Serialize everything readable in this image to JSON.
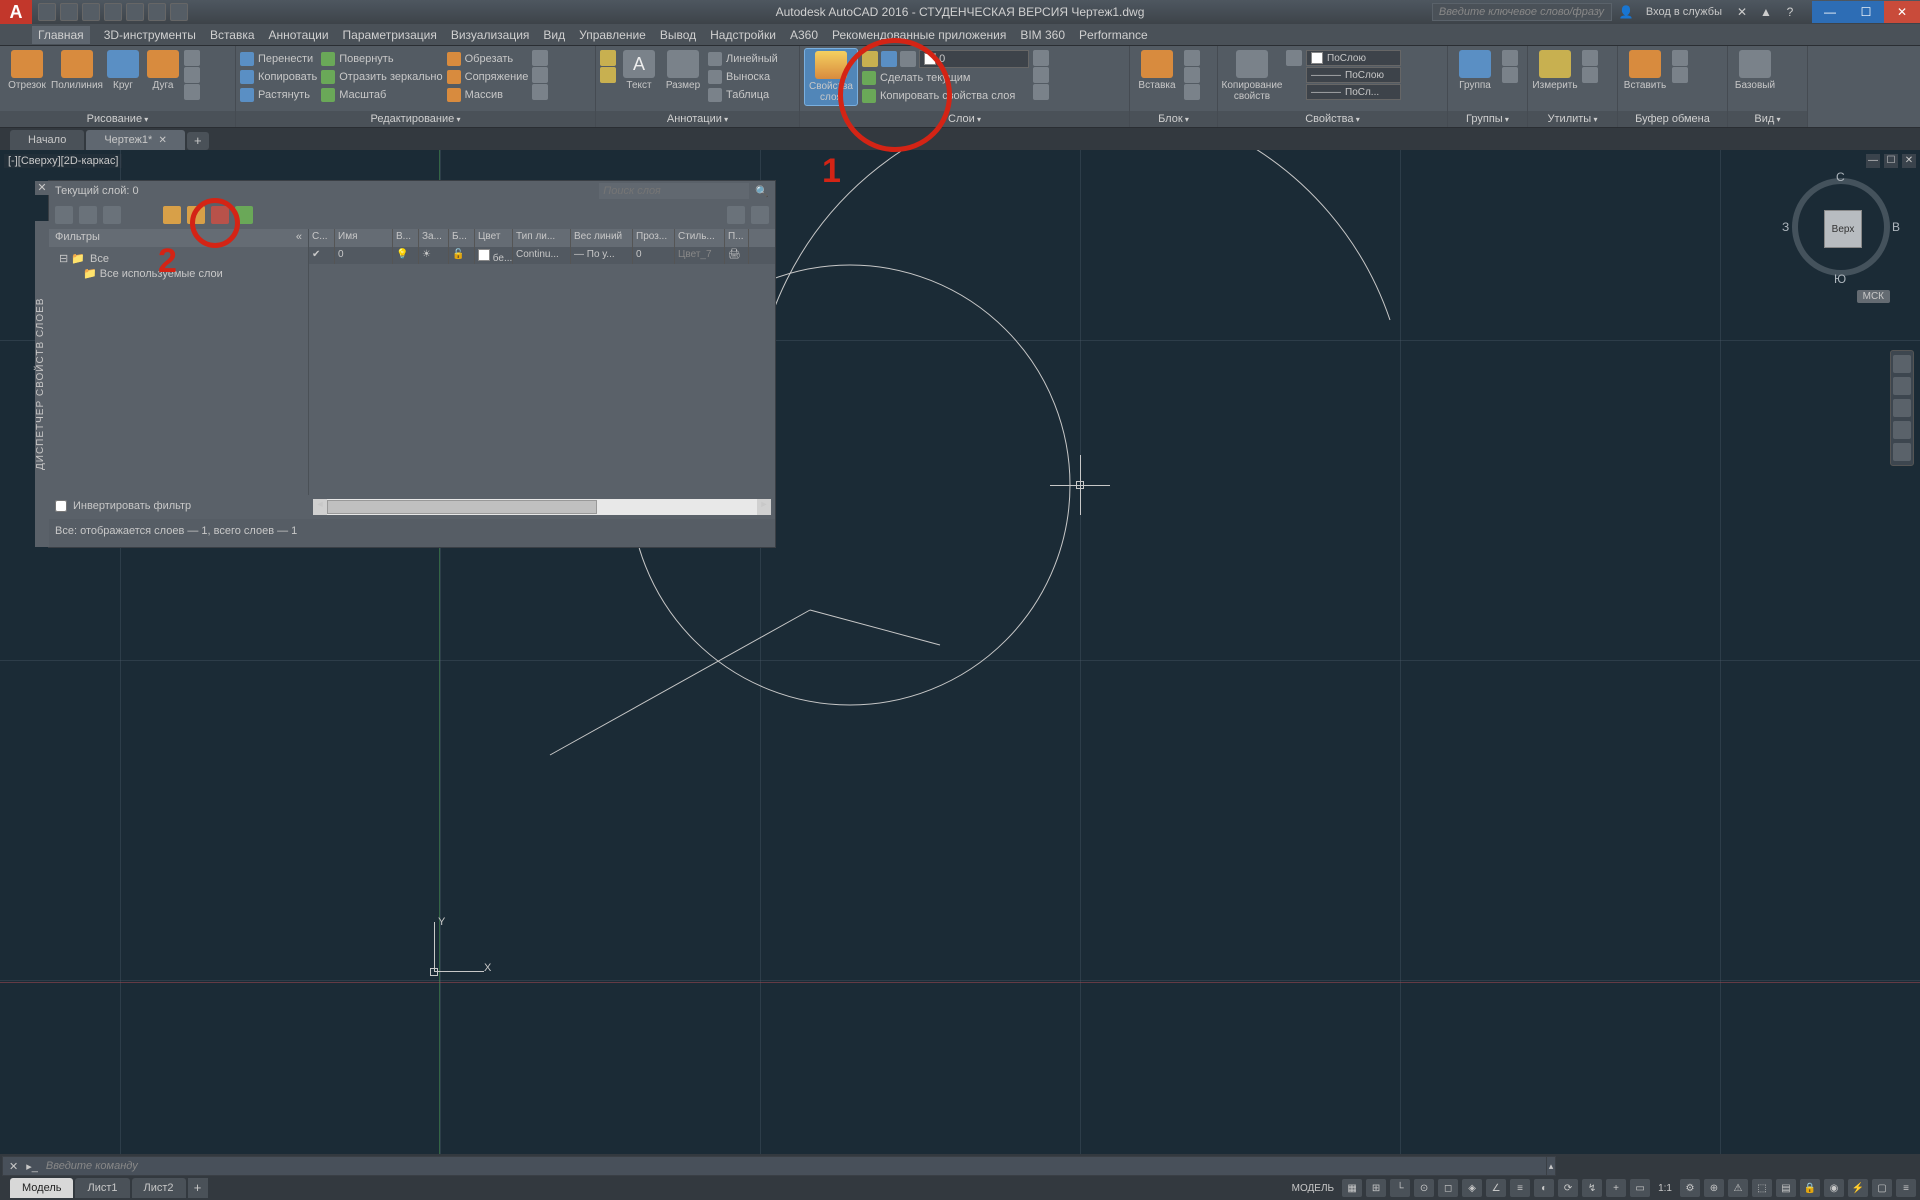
{
  "titlebar": {
    "app_title": "Autodesk AutoCAD 2016 - СТУДЕНЧЕСКАЯ ВЕРСИЯ    Чертеж1.dwg",
    "search_placeholder": "Введите ключевое слово/фразу",
    "login_text": "Вход в службы"
  },
  "menubar": [
    "Главная",
    "3D-инструменты",
    "Вставка",
    "Аннотации",
    "Параметризация",
    "Визуализация",
    "Вид",
    "Управление",
    "Вывод",
    "Надстройки",
    "A360",
    "Рекомендованные приложения",
    "BIM 360",
    "Performance"
  ],
  "ribbon": {
    "draw": {
      "title": "Рисование",
      "btns": {
        "line": "Отрезок",
        "pline": "Полилиния",
        "circle": "Круг",
        "arc": "Дуга"
      }
    },
    "modify": {
      "title": "Редактирование",
      "r1": "Перенести",
      "r2": "Копировать",
      "r3": "Растянуть",
      "r4": "Повернуть",
      "r5": "Отразить зеркально",
      "r6": "Масштаб",
      "r7": "Обрезать",
      "r8": "Сопряжение",
      "r9": "Массив"
    },
    "annot": {
      "title": "Аннотации",
      "text": "Текст",
      "dim": "Размер",
      "leader": "Выноска",
      "table": "Таблица",
      "linear": "Линейный"
    },
    "layers": {
      "title": "Слои",
      "props": "Свойства\nслоя",
      "make_current": "Сделать текущим",
      "match": "Копировать свойства слоя",
      "combo": "0"
    },
    "block": {
      "title": "Блок",
      "insert": "Вставка"
    },
    "props": {
      "title": "Свойства",
      "bylayer": "ПоСлою",
      "bylayer2": "ПоСлою",
      "bylayer3": "ПоСл...",
      "match": "Копирование\nсвойств"
    },
    "groups": {
      "title": "Группы",
      "btn": "Группа"
    },
    "utils": {
      "title": "Утилиты",
      "btn": "Измерить"
    },
    "clip": {
      "title": "Буфер обмена",
      "btn": "Вставить"
    },
    "view": {
      "title": "Вид",
      "btn": "Базовый"
    }
  },
  "filetabs": {
    "start": "Начало",
    "doc": "Чертеж1*"
  },
  "view_label": "[-][Сверху][2D-каркас]",
  "viewcube": {
    "face": "Верх",
    "n": "С",
    "s": "Ю",
    "e": "В",
    "w": "З",
    "wcs": "МСК"
  },
  "ucs": {
    "x": "X",
    "y": "Y"
  },
  "layer_palette": {
    "sidebar_title": "ДИСПЕТЧЕР СВОЙСТВ СЛОЕВ",
    "current": "Текущий слой: 0",
    "search_placeholder": "Поиск слоя",
    "filters_head": "Фильтры",
    "tree_all": "Все",
    "tree_used": "Все используемые слои",
    "cols": [
      "С...",
      "Имя",
      "В...",
      "За...",
      "Б...",
      "Цвет",
      "Тип ли...",
      "Вес линий",
      "Проз...",
      "Стиль...",
      "П..."
    ],
    "row": {
      "name": "0",
      "color": "бе...",
      "ltype": "Continu...",
      "lweight": "— По у...",
      "trans": "0",
      "plot": "Цвет_7"
    },
    "invert": "Инвертировать фильтр",
    "status": "Все: отображается слоев — 1, всего слоев — 1"
  },
  "annotations": {
    "a1": "1",
    "a2": "2"
  },
  "cmdline": {
    "prompt": "Введите команду"
  },
  "layout_tabs": {
    "model": "Модель",
    "l1": "Лист1",
    "l2": "Лист2"
  },
  "statusbar": {
    "model": "МОДЕЛЬ",
    "scale": "1:1"
  }
}
